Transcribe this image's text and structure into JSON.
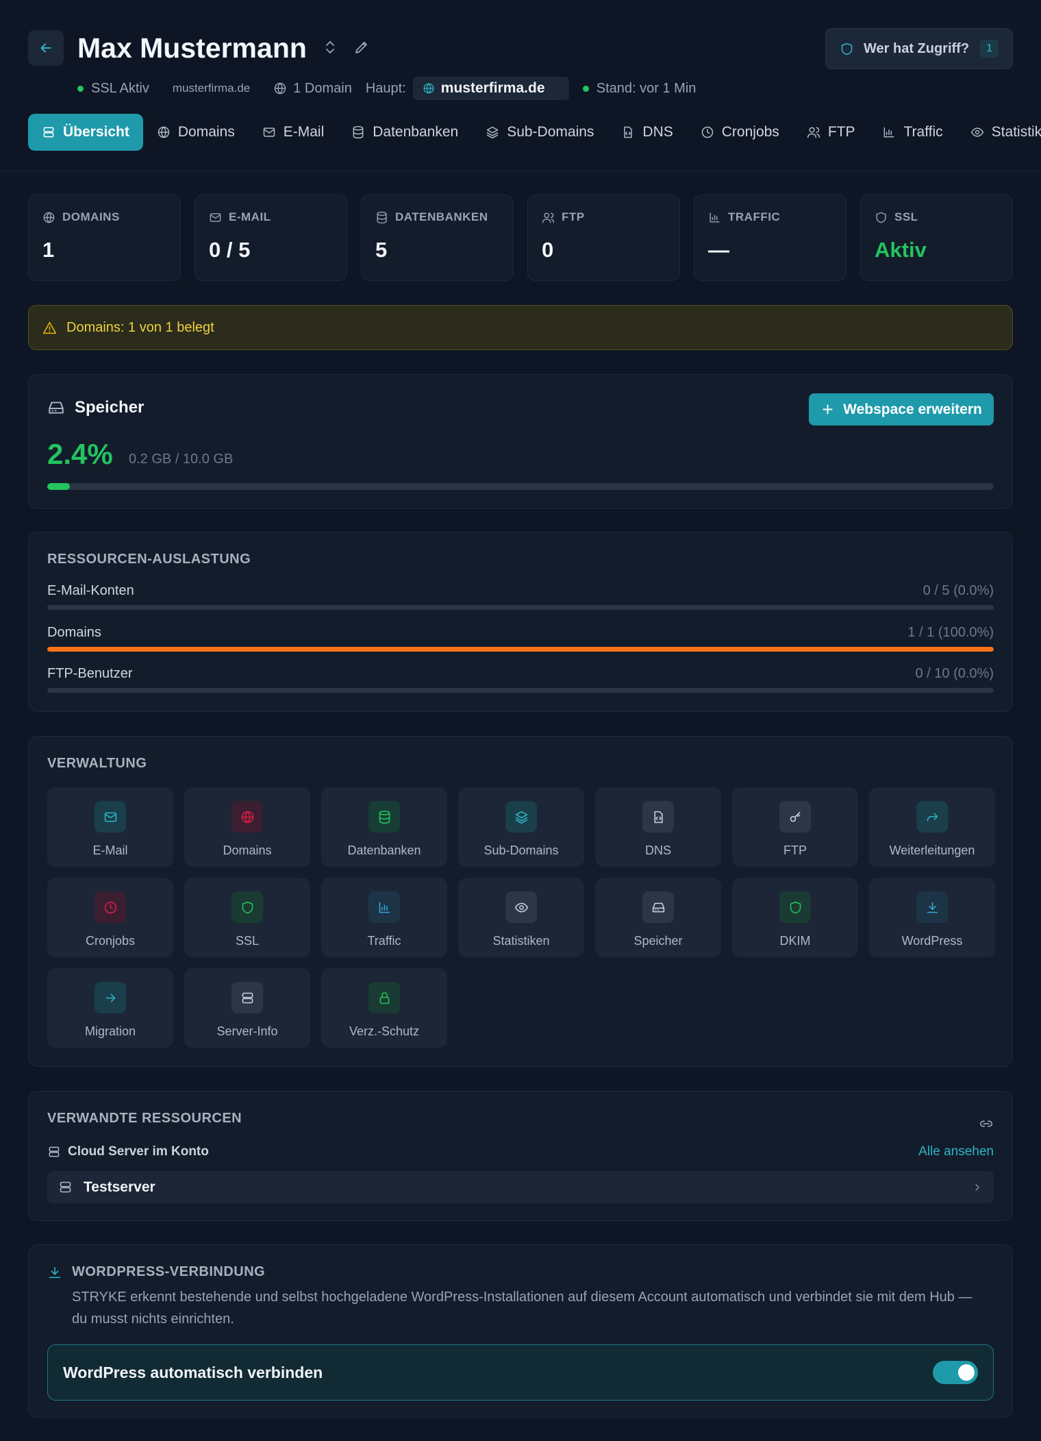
{
  "header": {
    "title": "Max Mustermann",
    "access_button": {
      "label": "Wer hat Zugriff?",
      "count": "1"
    },
    "meta": {
      "ssl_status": "SSL Aktiv",
      "domain_small": "musterfirma.de",
      "domain_count": "1 Domain",
      "main_label": "Haupt:",
      "main_domain": "musterfirma.de",
      "status": "Stand: vor 1 Min"
    },
    "tabs": [
      {
        "label": "Übersicht",
        "icon": "server-icon",
        "active": true
      },
      {
        "label": "Domains",
        "icon": "globe-icon"
      },
      {
        "label": "E-Mail",
        "icon": "mail-icon"
      },
      {
        "label": "Datenbanken",
        "icon": "database-icon"
      },
      {
        "label": "Sub-Domains",
        "icon": "layers-icon"
      },
      {
        "label": "DNS",
        "icon": "file-code-icon"
      },
      {
        "label": "Cronjobs",
        "icon": "clock-icon"
      },
      {
        "label": "FTP",
        "icon": "users-icon"
      },
      {
        "label": "Traffic",
        "icon": "bar-chart-icon"
      },
      {
        "label": "Statistiken",
        "icon": "eye-icon"
      }
    ]
  },
  "stats": [
    {
      "label": "DOMAINS",
      "value": "1",
      "icon": "globe-icon"
    },
    {
      "label": "E-MAIL",
      "value": "0 / 5",
      "icon": "mail-icon"
    },
    {
      "label": "DATENBANKEN",
      "value": "5",
      "icon": "database-icon"
    },
    {
      "label": "FTP",
      "value": "0",
      "icon": "users-icon"
    },
    {
      "label": "TRAFFIC",
      "value": "—",
      "icon": "bar-chart-icon"
    },
    {
      "label": "SSL",
      "value": "Aktiv",
      "icon": "shield-icon",
      "color": "#22c55e"
    }
  ],
  "alert": {
    "text": "Domains: 1 von 1 belegt",
    "icon": "warning-icon"
  },
  "storage": {
    "title": "Speicher",
    "expand_button": "Webspace erweitern",
    "percent": "2.4%",
    "detail": "0.2 GB / 10.0 GB",
    "fraction": 0.024
  },
  "resources": {
    "title": "RESSOURCEN-AUSLASTUNG",
    "rows": [
      {
        "name": "E-Mail-Konten",
        "value": "0 / 5 (0.0%)",
        "fraction": 0.0
      },
      {
        "name": "Domains",
        "value": "1 / 1 (100.0%)",
        "fraction": 1.0
      },
      {
        "name": "FTP-Benutzer",
        "value": "0 / 10 (0.0%)",
        "fraction": 0.0
      }
    ]
  },
  "management": {
    "title": "VERWALTUNG",
    "tiles": [
      {
        "label": "E-Mail",
        "icon": "mail-icon",
        "tone": "teal"
      },
      {
        "label": "Domains",
        "icon": "globe-icon",
        "tone": "red"
      },
      {
        "label": "Datenbanken",
        "icon": "database-icon",
        "tone": "green"
      },
      {
        "label": "Sub-Domains",
        "icon": "layers-icon",
        "tone": "teal"
      },
      {
        "label": "DNS",
        "icon": "file-code-icon",
        "tone": "gray"
      },
      {
        "label": "FTP",
        "icon": "key-icon",
        "tone": "gray"
      },
      {
        "label": "Weiterleitungen",
        "icon": "forward-icon",
        "tone": "teal"
      },
      {
        "label": "Cronjobs",
        "icon": "clock-icon",
        "tone": "red"
      },
      {
        "label": "SSL",
        "icon": "shield-icon",
        "tone": "dgreen"
      },
      {
        "label": "Traffic",
        "icon": "bar-chart-icon",
        "tone": "blue"
      },
      {
        "label": "Statistiken",
        "icon": "eye-icon",
        "tone": "gray"
      },
      {
        "label": "Speicher",
        "icon": "hard-drive-icon",
        "tone": "gray"
      },
      {
        "label": "DKIM",
        "icon": "shield-icon",
        "tone": "dgreen"
      },
      {
        "label": "WordPress",
        "icon": "download-icon",
        "tone": "blue"
      },
      {
        "label": "Migration",
        "icon": "arrow-right-icon",
        "tone": "teal"
      },
      {
        "label": "Server-Info",
        "icon": "server-icon",
        "tone": "gray"
      },
      {
        "label": "Verz.-Schutz",
        "icon": "lock-icon",
        "tone": "dgreen"
      }
    ]
  },
  "related": {
    "title": "VERWANDTE RESSOURCEN",
    "subtitle": "Cloud Server im Konto",
    "view_all": "Alle ansehen",
    "items": [
      {
        "label": "Testserver",
        "icon": "server-icon"
      }
    ]
  },
  "wordpress": {
    "title": "WORDPRESS-VERBINDUNG",
    "description": "STRYKE erkennt bestehende und selbst hochgeladene WordPress-Installationen auf diesem Account automatisch und verbindet sie mit dem Hub — du musst nichts einrichten.",
    "toggle_label": "WordPress automatisch verbinden",
    "toggle_on": true
  }
}
